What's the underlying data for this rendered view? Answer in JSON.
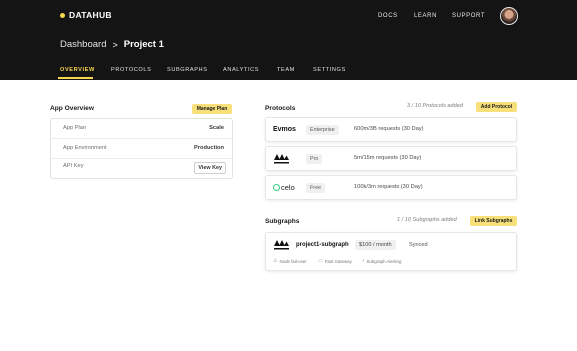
{
  "brand": {
    "name": "DATAHUB",
    "accent": "#f6d64a"
  },
  "topnav": {
    "items": [
      "DOCS",
      "LEARN",
      "SUPPORT"
    ]
  },
  "breadcrumb": {
    "parent": "Dashboard",
    "separator": ">",
    "current": "Project 1"
  },
  "tabs": [
    "OVERVIEW",
    "PROTOCOLS",
    "SUBGRAPHS",
    "ANALYTICS",
    "TEAM",
    "SETTINGS"
  ],
  "active_tab": "OVERVIEW",
  "overview": {
    "title": "App Overview",
    "button": "Manage Plan",
    "rows": [
      {
        "label": "App Plan",
        "value": "Scale"
      },
      {
        "label": "App Environment",
        "value": "Production"
      },
      {
        "label": "API Key",
        "value": "View Key"
      }
    ]
  },
  "protocols": {
    "title": "Protocols",
    "count_text": "3 / 10 Protocols added",
    "button": "Add Protocol",
    "items": [
      {
        "name": "Evmos",
        "icon": "evmos-logo",
        "plan": "Enterprise",
        "requests": "600m/3B requests (30 Day)"
      },
      {
        "name": "Avalanche",
        "icon": "avalanche-logo",
        "plan": "Pro",
        "requests": "5m/15m requests (30 Day)"
      },
      {
        "name": "celo",
        "icon": "celo-logo",
        "plan": "Free",
        "requests": "100k/3m requests (30 Day)"
      }
    ]
  },
  "subgraphs": {
    "title": "Subgraphs",
    "count_text": "1 / 10 Subgraphs added",
    "button": "Link Subgraphs",
    "items": [
      {
        "name": "project1-subgraph",
        "icon": "avalanche-logo",
        "price": "$100 / month",
        "status": "Synced",
        "features": [
          {
            "icon": "warning-icon",
            "label": "Node fail-over"
          },
          {
            "icon": "gateway-icon",
            "label": "Fast Gateway"
          },
          {
            "icon": "bell-icon",
            "label": "Subgraph Alerting"
          }
        ]
      }
    ]
  }
}
